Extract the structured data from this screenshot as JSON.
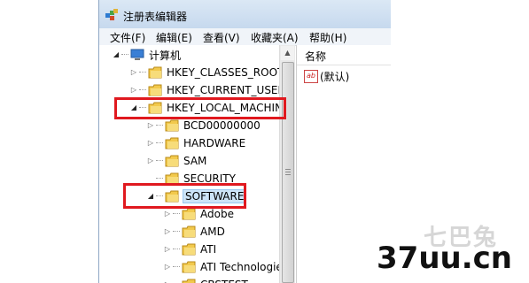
{
  "window": {
    "title": "注册表编辑器"
  },
  "menu": [
    {
      "label": "文件(F)"
    },
    {
      "label": "编辑(E)"
    },
    {
      "label": "查看(V)"
    },
    {
      "label": "收藏夹(A)"
    },
    {
      "label": "帮助(H)"
    }
  ],
  "tree": {
    "root": "计算机",
    "items": [
      {
        "label": "HKEY_CLASSES_ROOT",
        "expander": "▷"
      },
      {
        "label": "HKEY_CURRENT_USER",
        "expander": "▷"
      },
      {
        "label": "HKEY_LOCAL_MACHINE",
        "expander": "◢"
      },
      {
        "label": "BCD00000000",
        "expander": "▷"
      },
      {
        "label": "HARDWARE",
        "expander": "▷"
      },
      {
        "label": "SAM",
        "expander": "▷"
      },
      {
        "label": "SECURITY",
        "expander": ""
      },
      {
        "label": "SOFTWARE",
        "expander": "◢"
      },
      {
        "label": "Adobe",
        "expander": "▷"
      },
      {
        "label": "AMD",
        "expander": "▷"
      },
      {
        "label": "ATI",
        "expander": "▷"
      },
      {
        "label": "ATI Technologie",
        "expander": "▷"
      },
      {
        "label": "CBSTEST",
        "expander": "▷"
      }
    ]
  },
  "values_pane": {
    "column_header": "名称",
    "rows": [
      {
        "name": "(默认)"
      }
    ]
  },
  "watermark": {
    "text": "37uu.cn",
    "cn_text": "七巴兔"
  },
  "colors": {
    "highlight": "#e0191f",
    "selection": "#cce4f7",
    "folder": "#f2c94c"
  }
}
